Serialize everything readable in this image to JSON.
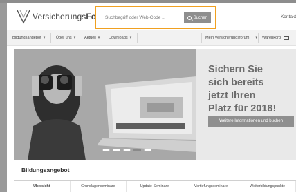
{
  "header": {
    "logo_prefix": "Versicherungs",
    "logo_suffix": "Forum",
    "search_placeholder": "Suchbegriff oder Web-Code ...",
    "search_button": "Suchen",
    "contact_label": "Kontakt"
  },
  "nav": {
    "items": [
      {
        "label": "Bildungsangebot"
      },
      {
        "label": "Über uns"
      },
      {
        "label": "Aktuell"
      },
      {
        "label": "Downloads"
      }
    ],
    "account_label": "Mein Versicherungsforum",
    "cart_label": "Warenkorb"
  },
  "hero": {
    "headline_1": "Sichern Sie",
    "headline_2": "sich bereits",
    "headline_3": "jetzt Ihren",
    "headline_4": "Platz für 2018!",
    "cta_label": "Weitere Informationen und buchen",
    "slides": [
      {
        "active": false
      },
      {
        "active": false
      },
      {
        "active": false
      },
      {
        "active": true
      },
      {
        "active": false
      }
    ]
  },
  "offers": {
    "title": "Bildungsangebot",
    "tabs": [
      {
        "label": "Übersicht",
        "active": true
      },
      {
        "label": "Grundlagenseminare",
        "active": false
      },
      {
        "label": "Update-Seminare",
        "active": false
      },
      {
        "label": "Vertiefungsseminare",
        "active": false
      },
      {
        "label": "Weiterbildungspunkte",
        "active": false
      }
    ]
  }
}
